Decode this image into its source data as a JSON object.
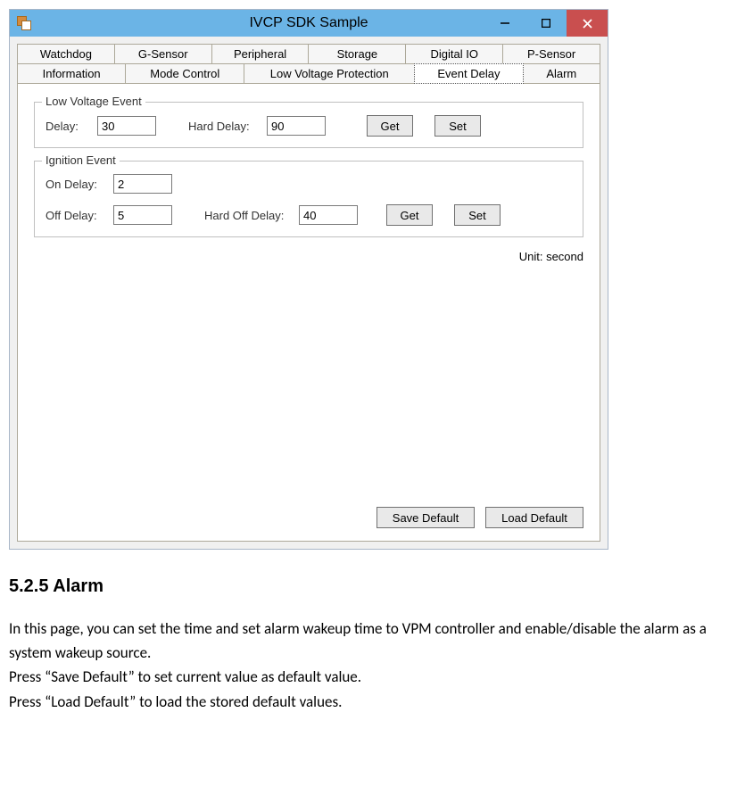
{
  "window": {
    "title": "IVCP SDK Sample"
  },
  "tabs_row1": [
    "Watchdog",
    "G-Sensor",
    "Peripheral",
    "Storage",
    "Digital IO",
    "P-Sensor"
  ],
  "tabs_row2": [
    "Information",
    "Mode Control",
    "Low Voltage Protection",
    "Event Delay",
    "Alarm"
  ],
  "groups": {
    "lowVoltage": {
      "title": "Low Voltage Event",
      "delayLabel": "Delay:",
      "delayValue": "30",
      "hardDelayLabel": "Hard Delay:",
      "hardDelayValue": "90",
      "getLabel": "Get",
      "setLabel": "Set"
    },
    "ignition": {
      "title": "Ignition Event",
      "onDelayLabel": "On Delay:",
      "onDelayValue": "2",
      "offDelayLabel": "Off Delay:",
      "offDelayValue": "5",
      "hardOffDelayLabel": "Hard Off Delay:",
      "hardOffDelayValue": "40",
      "getLabel": "Get",
      "setLabel": "Set"
    }
  },
  "unitText": "Unit: second",
  "bottomButtons": {
    "save": "Save Default",
    "load": "Load Default"
  },
  "doc": {
    "heading": "5.2.5 Alarm",
    "p1": "In this page, you can set the time and set alarm wakeup time to VPM controller and enable/disable the alarm as a system wakeup source.",
    "p2": "Press “Save Default” to set current value as default value.",
    "p3": "Press “Load Default” to load the stored default values."
  }
}
